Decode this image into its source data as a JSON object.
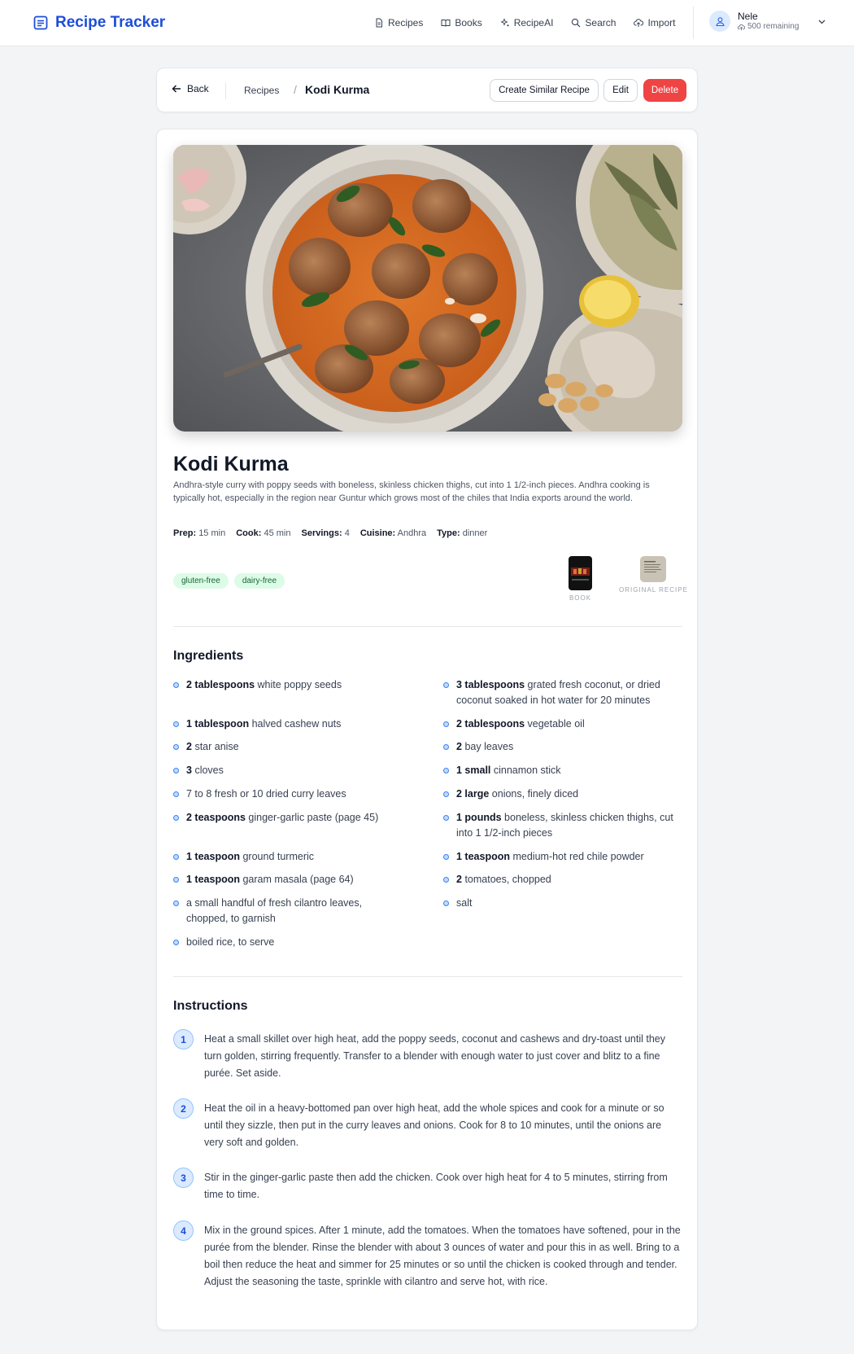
{
  "nav": {
    "brand": "Recipe Tracker",
    "links": [
      "Recipes",
      "Books",
      "RecipeAI",
      "Search",
      "Import"
    ],
    "user_name": "Nele",
    "user_remaining": "500 remaining"
  },
  "breadcrumb": {
    "back": "Back",
    "parent": "Recipes",
    "separator": "/",
    "current": "Kodi Kurma",
    "buttons": {
      "similar": "Create Similar Recipe",
      "edit": "Edit",
      "delete": "Delete"
    }
  },
  "recipe": {
    "title": "Kodi Kurma",
    "description": "Andhra-style curry with poppy seeds with boneless, skinless chicken thighs, cut into 1 1/2-inch pieces. Andhra cooking is typically hot, especially in the region near Guntur which grows most of the chiles that India exports around the world.",
    "meta": [
      {
        "label": "Prep:",
        "value": "15 min"
      },
      {
        "label": "Cook:",
        "value": "45 min"
      },
      {
        "label": "Servings:",
        "value": "4"
      },
      {
        "label": "Cuisine:",
        "value": "Andhra"
      },
      {
        "label": "Type:",
        "value": "dinner"
      }
    ],
    "tags": [
      "gluten-free",
      "dairy-free"
    ],
    "sources": {
      "book": "BOOK",
      "original": "ORIGINAL RECIPE"
    }
  },
  "ingredients": {
    "heading": "Ingredients",
    "left": [
      {
        "qty": "2 tablespoons",
        "text": "white poppy seeds"
      },
      {
        "qty": "1 tablespoon",
        "text": "halved cashew nuts"
      },
      {
        "qty": "2",
        "text": "star anise"
      },
      {
        "qty": "3",
        "text": "cloves"
      },
      {
        "qty": "",
        "text": "7 to 8 fresh or 10 dried curry leaves"
      },
      {
        "qty": "2 teaspoons",
        "text": "ginger-garlic paste (page 45)"
      },
      {
        "qty": "1 teaspoon",
        "text": "ground turmeric"
      },
      {
        "qty": "1 teaspoon",
        "text": "garam masala (page 64)"
      },
      {
        "qty": "",
        "text": "a small handful of fresh cilantro leaves, chopped, to garnish"
      },
      {
        "qty": "",
        "text": "boiled rice, to serve"
      }
    ],
    "right": [
      {
        "qty": "3 tablespoons",
        "text": "grated fresh coconut, or dried coconut soaked in hot water for 20 minutes"
      },
      {
        "qty": "2 tablespoons",
        "text": "vegetable oil"
      },
      {
        "qty": "2",
        "text": "bay leaves"
      },
      {
        "qty": "1 small",
        "text": "cinnamon stick"
      },
      {
        "qty": "2 large",
        "text": "onions, finely diced"
      },
      {
        "qty": "1 pounds",
        "text": "boneless, skinless chicken thighs, cut into 1 1/2-inch pieces"
      },
      {
        "qty": "1 teaspoon",
        "text": "medium-hot red chile powder"
      },
      {
        "qty": "2",
        "text": "tomatoes, chopped"
      },
      {
        "qty": "",
        "text": "salt"
      }
    ]
  },
  "instructions": {
    "heading": "Instructions",
    "steps": [
      {
        "num": "1",
        "text": "Heat a small skillet over high heat, add the poppy seeds, coconut and cashews and dry-toast until they turn golden, stirring frequently. Transfer to a blender with enough water to just cover and blitz to a fine purée. Set aside."
      },
      {
        "num": "2",
        "text": "Heat the oil in a heavy-bottomed pan over high heat, add the whole spices and cook for a minute or so until they sizzle, then put in the curry leaves and onions. Cook for 8 to 10 minutes, until the onions are very soft and golden."
      },
      {
        "num": "3",
        "text": "Stir in the ginger-garlic paste then add the chicken. Cook over high heat for 4 to 5 minutes, stirring from time to time."
      },
      {
        "num": "4",
        "text": "Mix in the ground spices. After 1 minute, add the tomatoes. When the tomatoes have softened, pour in the purée from the blender. Rinse the blender with about 3 ounces of water and pour this in as well. Bring to a boil then reduce the heat and simmer for 25 minutes or so until the chicken is cooked through and tender. Adjust the seasoning the taste, sprinkle with cilantro and serve hot, with rice."
      }
    ]
  },
  "colors": {
    "brand": "#1d4ed8",
    "delete": "#ef4444",
    "tag_bg": "#dcfce7",
    "tag_text": "#166534",
    "step_badge": "#dbeafe"
  },
  "icons": [
    "document-icon",
    "book-icon",
    "sparkles-icon",
    "search-icon",
    "upload-icon",
    "user-icon",
    "chevron-down-icon",
    "arrow-left-icon"
  ]
}
